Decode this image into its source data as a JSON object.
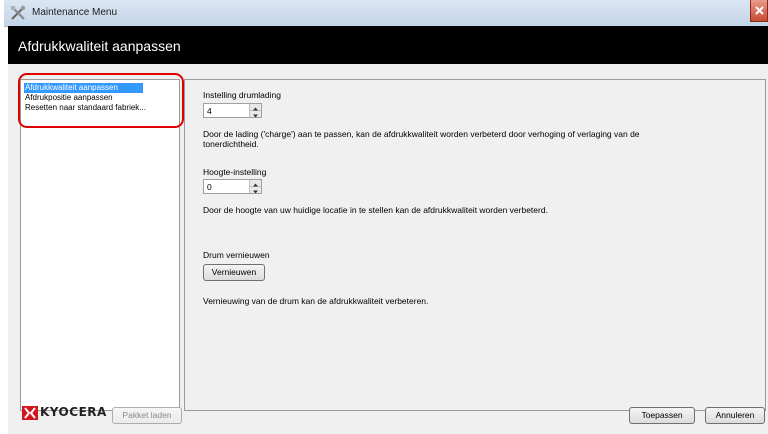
{
  "window": {
    "title": "Maintenance Menu"
  },
  "header": {
    "title": "Afdrukkwaliteit aanpassen"
  },
  "sidebar": {
    "items": [
      {
        "label": "Afdrukkwaliteit aanpassen",
        "selected": true
      },
      {
        "label": "Afdrukpositie aanpassen",
        "selected": false
      },
      {
        "label": "Resetten naar standaard fabriek...",
        "selected": false
      }
    ]
  },
  "main": {
    "drum_charge": {
      "label": "Instelling drumlading",
      "value": "4",
      "description": "Door de lading ('charge') aan te passen, kan de afdrukkwaliteit worden verbeterd door verhoging of verlaging van de tonerdichtheid."
    },
    "altitude": {
      "label": "Hoogte-instelling",
      "value": "0",
      "description": "Door de hoogte van uw huidige locatie in te stellen kan de afdrukkwaliteit worden verbeterd."
    },
    "drum_refresh": {
      "label": "Drum vernieuwen",
      "button_label": "Vernieuwen",
      "description": "Vernieuwing van de drum kan de afdrukkwaliteit verbeteren."
    }
  },
  "footer": {
    "logo_text": "KYOCERA",
    "load_package_label": "Pakket laden",
    "apply_label": "Toepassen",
    "cancel_label": "Annuleren"
  },
  "colors": {
    "header_bg": "#000000",
    "selection": "#3399ff",
    "highlight_ring": "#e00000",
    "logo_red": "#d2141e"
  }
}
